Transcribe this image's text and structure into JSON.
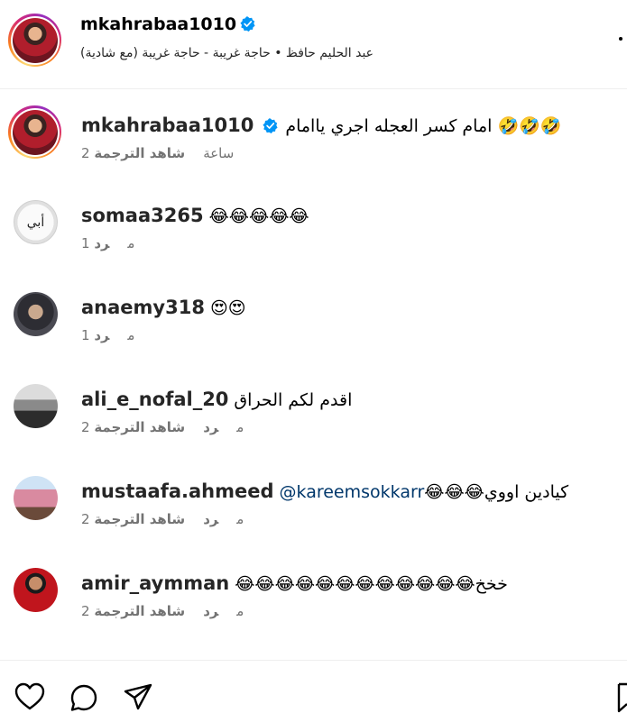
{
  "post_header": {
    "username": "mkahrabaa1010",
    "subtitle": "عبد الحليم حافظ  •  حاجة غريبة - حاجة غريبة (مع شادية)"
  },
  "caption": {
    "username": "mkahrabaa1010",
    "text": "امام كسر العجله اجري ياامام 🤣🤣🤣",
    "time": "2 ساعة",
    "translation": "شاهد الترجمة"
  },
  "comments": [
    {
      "username": "somaa3265",
      "text": "😂😂😂😂😂",
      "time": "1 م",
      "reply": "رد"
    },
    {
      "username": "anaemy318",
      "text": "😍😍",
      "time": "1 م",
      "reply": "رد"
    },
    {
      "username": "ali_e_nofal_20",
      "text": "اقدم لكم الحراق",
      "time": "2 م",
      "reply": "رد",
      "translation": "شاهد الترجمة"
    },
    {
      "username": "mustaafa.ahmeed",
      "mention": "@kareemsokkarr",
      "text": "😂😂😂كيادين اووي",
      "time": "2 م",
      "reply": "رد",
      "translation": "شاهد الترجمة"
    },
    {
      "username": "amir_aymman",
      "text": "😂😂😂😂😂😂😂😂😂😂😂😂خخخ",
      "time": "2 م",
      "reply": "رد",
      "translation": "شاهد الترجمة"
    }
  ],
  "colors": {
    "verified_blue": "#0095f6",
    "meta_gray": "#737373",
    "mention_blue": "#00376b"
  },
  "icons": [
    "heart-icon",
    "comment-icon",
    "share-icon",
    "bookmark-icon",
    "verified-icon"
  ]
}
